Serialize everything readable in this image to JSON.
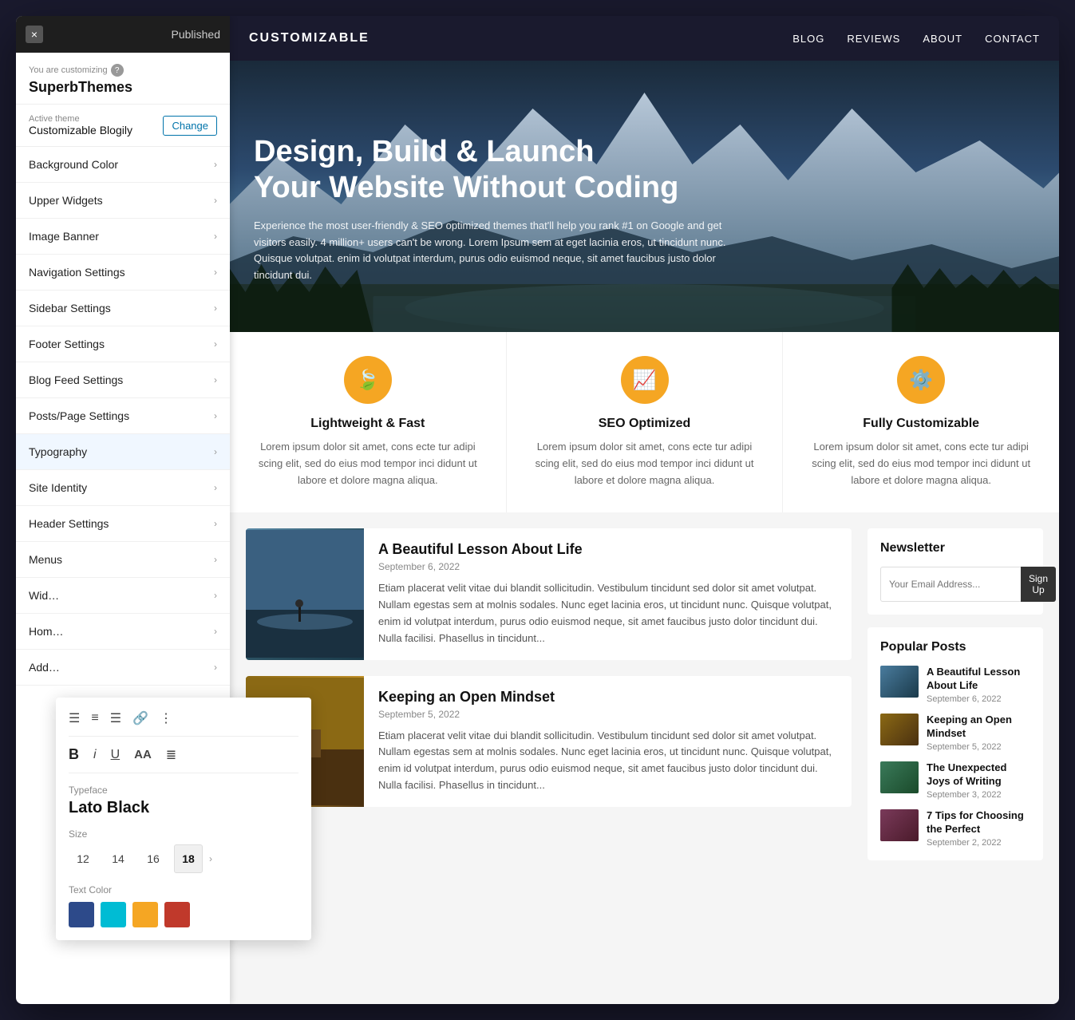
{
  "panel": {
    "close_label": "×",
    "published": "Published",
    "customizing_text": "You are customizing",
    "help": "?",
    "site_name": "SuperbThemes",
    "theme_label": "Active theme",
    "theme_name": "Customizable Blogily",
    "change_btn": "Change",
    "menu_items": [
      {
        "label": "Background Color",
        "id": "background-color"
      },
      {
        "label": "Upper Widgets",
        "id": "upper-widgets"
      },
      {
        "label": "Image Banner",
        "id": "image-banner"
      },
      {
        "label": "Navigation Settings",
        "id": "navigation-settings"
      },
      {
        "label": "Sidebar Settings",
        "id": "sidebar-settings"
      },
      {
        "label": "Footer Settings",
        "id": "footer-settings"
      },
      {
        "label": "Blog Feed Settings",
        "id": "blog-feed-settings"
      },
      {
        "label": "Posts/Page Settings",
        "id": "posts-page-settings"
      },
      {
        "label": "Typography",
        "id": "typography",
        "active": true
      },
      {
        "label": "Site Identity",
        "id": "site-identity"
      },
      {
        "label": "Header Settings",
        "id": "header-settings"
      },
      {
        "label": "Menus",
        "id": "menus"
      },
      {
        "label": "Wid…",
        "id": "widgets"
      },
      {
        "label": "Hom…",
        "id": "homepage"
      },
      {
        "label": "Add…",
        "id": "additional"
      }
    ]
  },
  "typography_popup": {
    "toolbar_icons": [
      "align-left",
      "align-center",
      "align-right",
      "link",
      "list"
    ],
    "format_icons": [
      "bold",
      "italic",
      "underline",
      "aa",
      "paragraph"
    ],
    "typeface_label": "Typeface",
    "typeface_value": "Lato Black",
    "size_label": "Size",
    "sizes": [
      "12",
      "14",
      "16",
      "18"
    ],
    "selected_size": "18",
    "color_label": "Text Color",
    "colors": [
      "#2d4a8a",
      "#00bcd4",
      "#f5a623",
      "#c0392b"
    ]
  },
  "site": {
    "logo": "CUSTOMIZABLE",
    "nav_links": [
      "BLOG",
      "REVIEWS",
      "ABOUT",
      "CONTACT"
    ]
  },
  "hero": {
    "title": "Design, Build & Launch\nYour Website Without Coding",
    "description": "Experience the most user-friendly & SEO optimized themes that'll help you rank #1 on Google and get visitors easily. 4 million+ users can't be wrong. Lorem Ipsum sem at eget lacinia eros, ut tincidunt nunc. Quisque volutpat. enim id volutpat interdum, purus odio euismod neque, sit amet faucibus justo dolor tincidunt dui."
  },
  "features": [
    {
      "icon": "🍃",
      "title": "Lightweight & Fast",
      "desc": "Lorem ipsum dolor sit amet, cons ecte tur adipi scing elit, sed do eius mod tempor inci didunt ut labore et dolore magna aliqua."
    },
    {
      "icon": "📈",
      "title": "SEO Optimized",
      "desc": "Lorem ipsum dolor sit amet, cons ecte tur adipi scing elit, sed do eius mod tempor inci didunt ut labore et dolore magna aliqua."
    },
    {
      "icon": "⚙️",
      "title": "Fully Customizable",
      "desc": "Lorem ipsum dolor sit amet, cons ecte tur adipi scing elit, sed do eius mod tempor inci didunt ut labore et dolore magna aliqua."
    }
  ],
  "blog": {
    "posts": [
      {
        "title": "A Beautiful Lesson About Life",
        "date": "September 6, 2022",
        "excerpt": "Etiam placerat velit vitae dui blandit sollicitudin. Vestibulum tincidunt sed dolor sit amet volutpat. Nullam egestas sem at molnis sodales. Nunc eget lacinia eros, ut tincidunt nunc. Quisque volutpat, enim id volutpat interdum, purus odio euismod neque, sit amet faucibus justo dolor tincidunt dui. Nulla facilisi. Phasellus in tincidunt..."
      },
      {
        "title": "Keeping an Open Mindset",
        "date": "September 5, 2022",
        "excerpt": "Etiam placerat velit vitae dui blandit sollicitudin. Vestibulum tincidunt sed dolor sit amet volutpat. Nullam egestas sem at molnis sodales. Nunc eget lacinia eros, ut tincidunt nunc. Quisque volutpat, enim id volutpat interdum, purus odio euismod neque, sit amet faucibus justo dolor tincidunt dui. Nulla facilisi. Phasellus in tincidunt..."
      }
    ]
  },
  "sidebar": {
    "newsletter_title": "Newsletter",
    "newsletter_placeholder": "Your Email Address...",
    "newsletter_btn": "Sign Up",
    "popular_title": "Popular Posts",
    "popular_posts": [
      {
        "title": "A Beautiful Lesson About Life",
        "date": "September 6, 2022"
      },
      {
        "title": "Keeping an Open Mindset",
        "date": "September 5, 2022"
      },
      {
        "title": "The Unexpected Joys of Writing",
        "date": "September 3, 2022"
      },
      {
        "title": "7 Tips for Choosing the Perfect",
        "date": "September 2, 2022"
      }
    ]
  }
}
